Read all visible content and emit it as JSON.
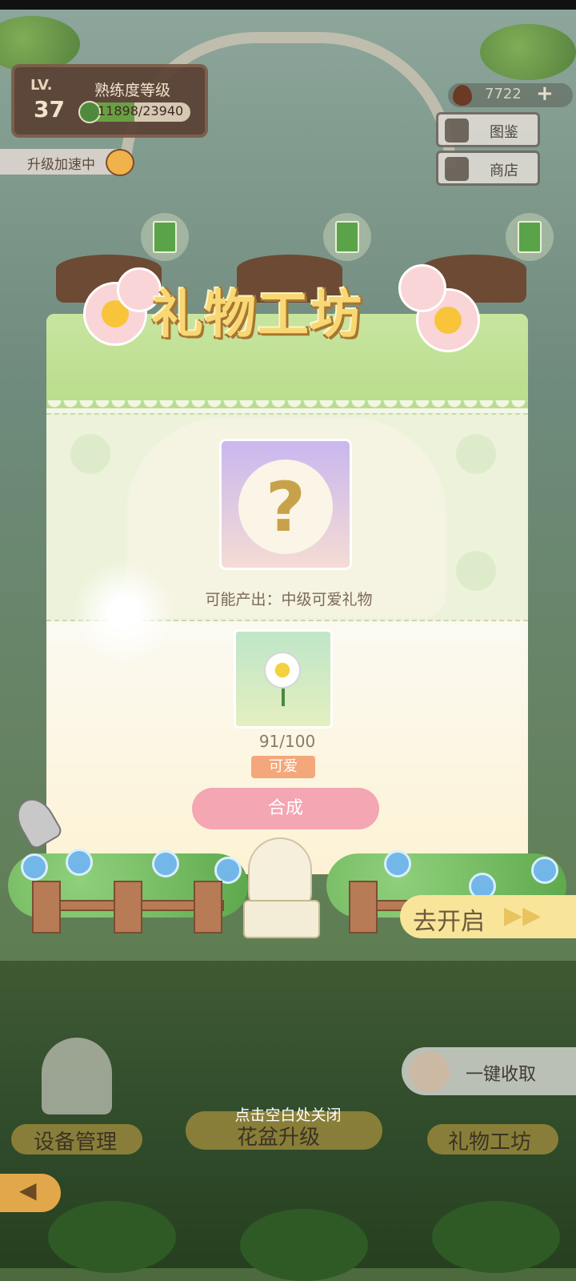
{
  "hud": {
    "level_label": "LV.",
    "level_value": "37",
    "proficiency_title": "熟练度等级",
    "proficiency_text": "11898/23940",
    "proficiency_fraction": 0.497,
    "speedup_text": "升级加速中",
    "seed_count": "7722",
    "seed_plus": "+"
  },
  "side_buttons": [
    {
      "label": "图鉴",
      "icon": "book-icon"
    },
    {
      "label": "商店",
      "icon": "shop-icon"
    }
  ],
  "modal": {
    "title": "礼物工坊",
    "mystery_symbol": "?",
    "output_label": "可能产出：中级可爱礼物",
    "ingredient_count": "91/100",
    "ingredient_tag": "可爱",
    "synthesize_label": "合成"
  },
  "go_open": {
    "label": "去开启",
    "arrow": "▶▶"
  },
  "collect_all": {
    "label": "一键收取"
  },
  "bottom_nav": [
    {
      "label": "设备管理"
    },
    {
      "label": "花盆升级"
    },
    {
      "label": "礼物工坊"
    }
  ],
  "close_hint": "点击空白处关闭",
  "colors": {
    "synthesize_button": "#f4a6b2",
    "tag": "#f4a77a",
    "title": "#f7d874",
    "modal_header": "#c8e59f"
  }
}
